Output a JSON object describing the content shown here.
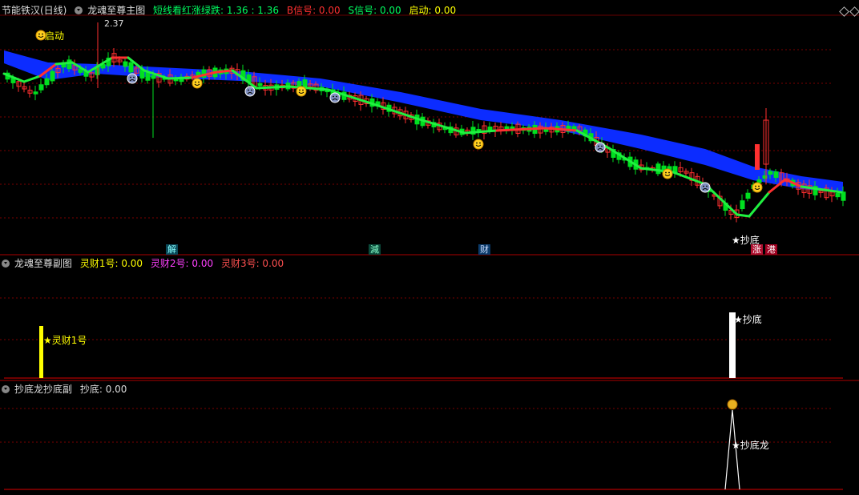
{
  "main_panel": {
    "stock_title": "节能铁汉(日线)",
    "indicator_name": "龙魂至尊主图",
    "short_line_label": "短线看红涨绿跌: 1.36 : 1.36",
    "b_signal_label": "B信号: 0.00",
    "s_signal_label": "S信号: 0.00",
    "start_label": "启动: 0.00",
    "peak_price_label": "2.37",
    "start_marker_label": "启动",
    "bottom_marker_label": "★抄底",
    "bottom_tags": [
      "解",
      "減",
      "财",
      "涨",
      "港"
    ]
  },
  "sub_panel_1": {
    "indicator_name": "龙魂至尊副图",
    "ling1_label": "灵财1号: 0.00",
    "ling2_label": "灵财2号: 0.00",
    "ling3_label": "灵财3号: 0.00",
    "marker_ling1": "★灵财1号",
    "marker_bottom": "★抄底"
  },
  "sub_panel_2": {
    "indicator_name": "抄底龙抄底副",
    "value_label": "抄底: 0.00",
    "marker_label": "★抄底龙"
  },
  "colors": {
    "up": "#ff3030",
    "down": "#00e020",
    "ribbon": "#0c2cff",
    "yellow": "#ffff00",
    "magenta": "#ff40ff",
    "grid": "#7a0000"
  }
}
